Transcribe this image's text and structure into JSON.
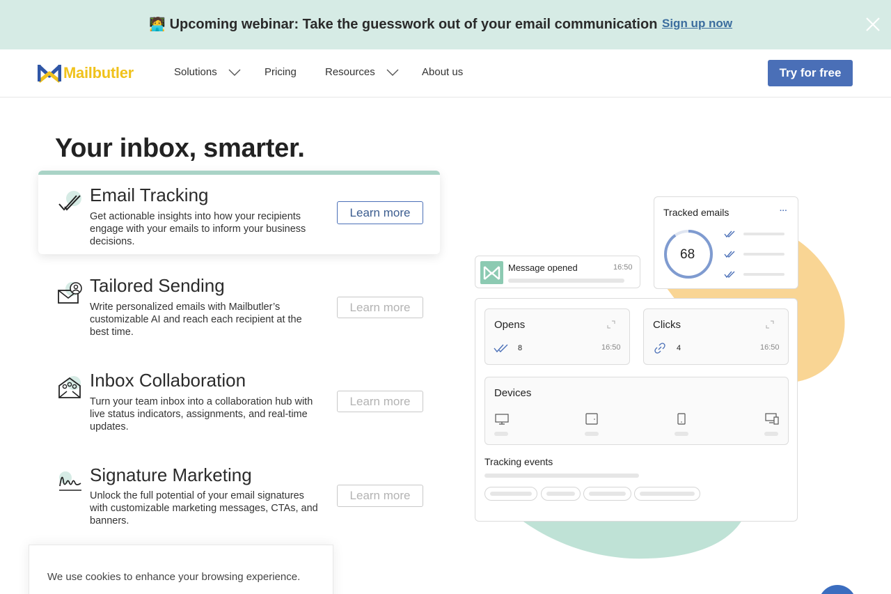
{
  "banner": {
    "emoji": "🧑‍💻",
    "text": "Upcoming webinar: Take the guesswork out of your email communication",
    "link": "Sign up now"
  },
  "nav": {
    "logo_text": "Mailbutler",
    "items": [
      {
        "label": "Solutions",
        "has_dropdown": true
      },
      {
        "label": "Pricing",
        "has_dropdown": false
      },
      {
        "label": "Resources",
        "has_dropdown": true
      },
      {
        "label": "About us",
        "has_dropdown": false
      }
    ],
    "cta": "Try for free"
  },
  "hero": {
    "title": "Your inbox, smarter."
  },
  "features": [
    {
      "title": "Email Tracking",
      "desc": "Get actionable insights into how your recipients engage with your emails to inform your business decisions.",
      "button": "Learn more",
      "active": true,
      "icon": "double-check-icon"
    },
    {
      "title": "Tailored Sending",
      "desc": "Write personalized emails with Mailbutler’s customizable AI and reach each recipient at the best time.",
      "button": "Learn more",
      "active": false,
      "icon": "envelope-person-icon"
    },
    {
      "title": "Inbox Collaboration",
      "desc": "Turn your team inbox into a collaboration hub with live status indicators, assignments, and real-time updates.",
      "button": "Learn more",
      "active": false,
      "icon": "team-envelope-icon"
    },
    {
      "title": "Signature Marketing",
      "desc": "Unlock the full potential of your email signatures with customizable marketing messages, CTAs, and banners.",
      "button": "Learn more",
      "active": false,
      "icon": "signature-icon"
    }
  ],
  "illustration": {
    "message_opened": {
      "label": "Message opened",
      "time": "16:50"
    },
    "tracked_emails": {
      "title": "Tracked emails",
      "count": "68",
      "menu": "···"
    },
    "opens": {
      "title": "Opens",
      "value": "8",
      "time": "16:50"
    },
    "clicks": {
      "title": "Clicks",
      "value": "4",
      "time": "16:50"
    },
    "devices": {
      "title": "Devices"
    },
    "tracking_events": {
      "title": "Tracking events"
    }
  },
  "cookie": {
    "text": "We use cookies to enhance your browsing experience."
  },
  "colors": {
    "banner_bg": "#d6ebe5",
    "accent_blue": "#4a6fb7",
    "accent_green": "#a9d3c6",
    "blob_yellow": "#f9d594",
    "blob_green": "#bfe2d6"
  }
}
